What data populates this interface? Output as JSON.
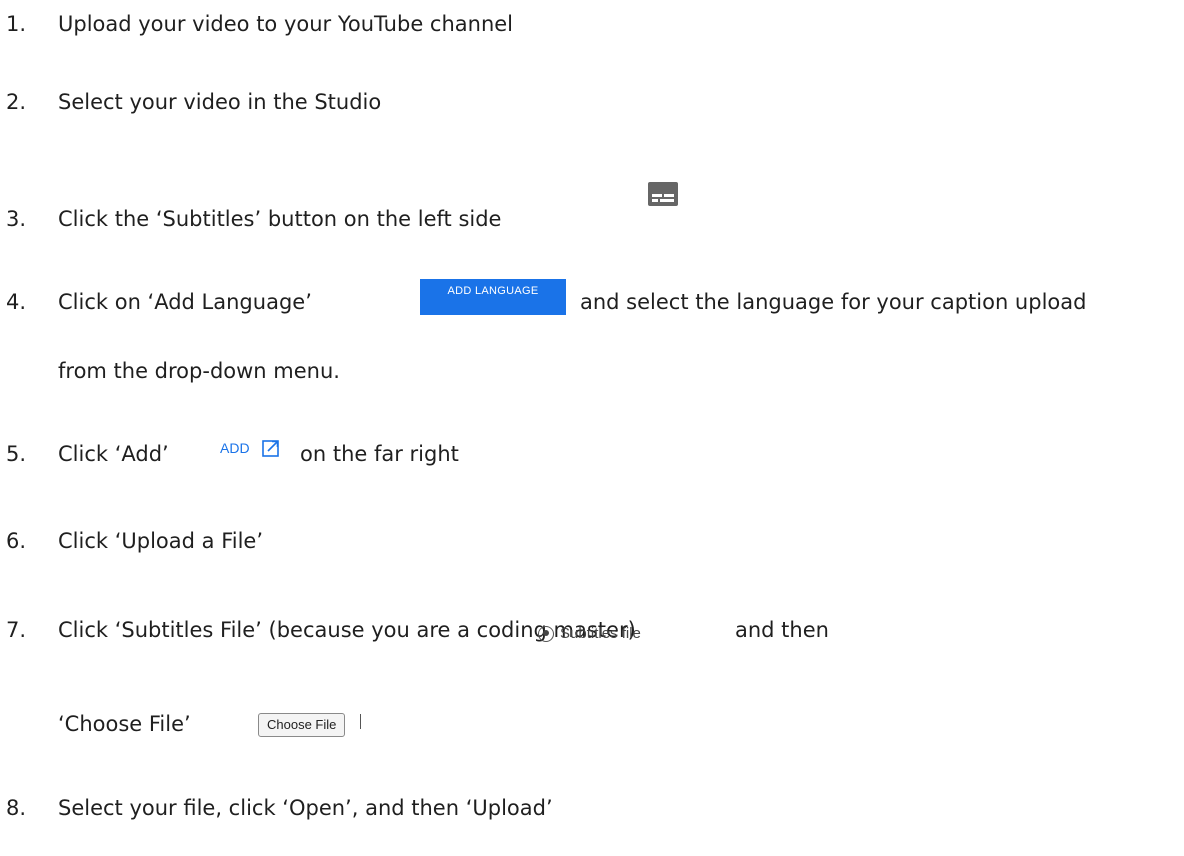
{
  "steps": [
    {
      "num": "1.",
      "text": "Upload your video to your YouTube channel"
    },
    {
      "num": "2.",
      "text": "Select your video in the Studio"
    },
    {
      "num": "3.",
      "text": "Click the ‘Subtitles’ button on the left side"
    },
    {
      "num": "4.",
      "text": "Click on ‘Add Language’",
      "after": "and select the language for your caption upload",
      "cont": "from the drop-down menu."
    },
    {
      "num": "5.",
      "text": "Click ‘Add’",
      "after": "on the far right"
    },
    {
      "num": "6.",
      "text": "Click ‘Upload a File’"
    },
    {
      "num": "7.",
      "text": "Click ‘Subtitles File’ (because you are a coding master)",
      "after": "and then",
      "cont": "‘Choose File’"
    },
    {
      "num": "8.",
      "text": "Select your file, click ‘Open’, and then ‘Upload’"
    }
  ],
  "ui": {
    "add_language_label": "ADD LANGUAGE",
    "add_label": "ADD",
    "subtitles_file_label": "Subtitles file",
    "choose_file_label": "Choose File"
  },
  "icons": {
    "subtitles": "subtitles-icon",
    "external_link": "external-link-icon",
    "radio": "radio-selected-icon"
  },
  "colors": {
    "accent_blue": "#1a73e8",
    "icon_gray": "#666666",
    "text": "#1f1f1f"
  }
}
